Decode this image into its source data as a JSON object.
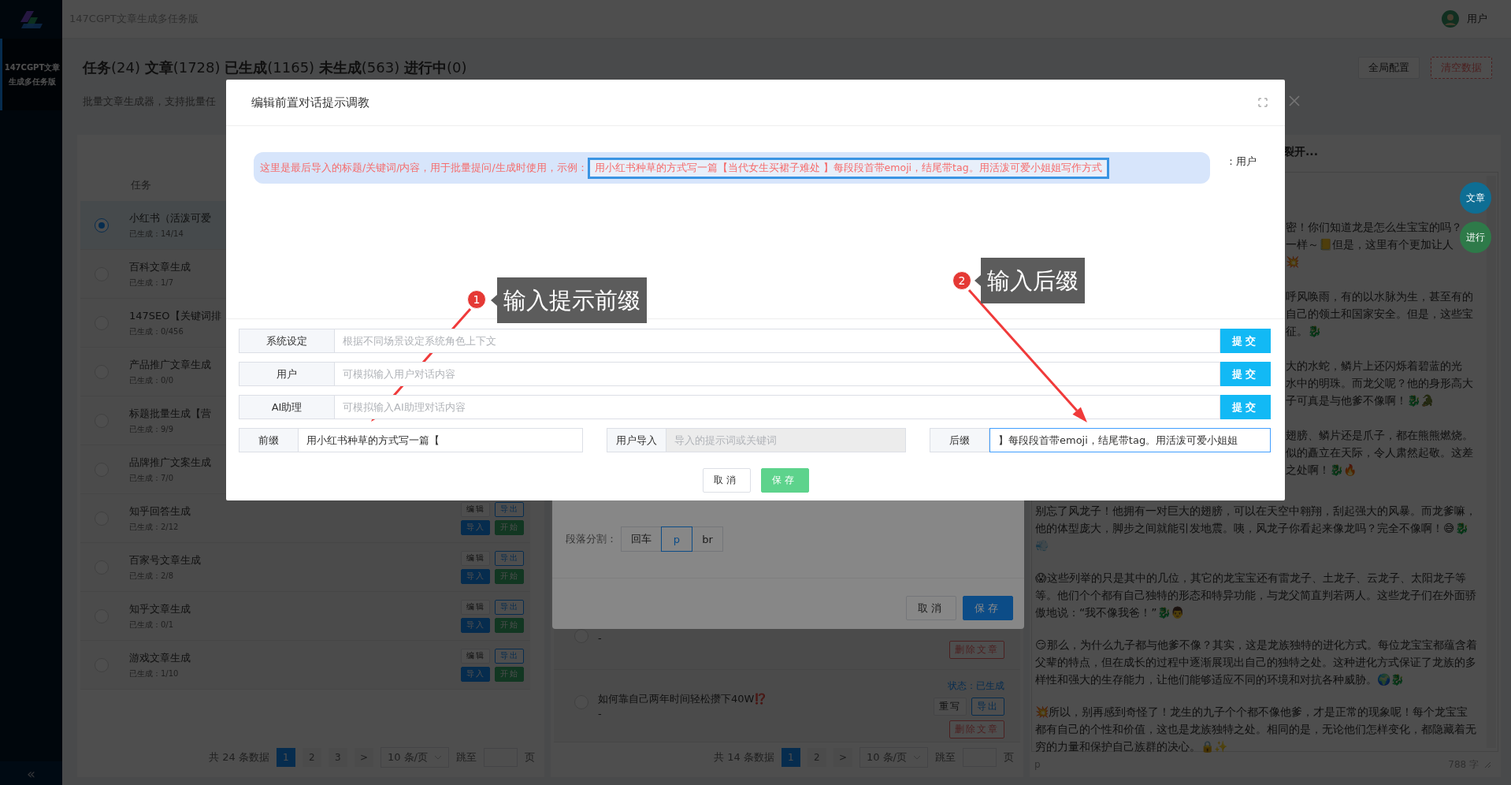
{
  "header": {
    "title": "147CGPT文章生成多任务版",
    "user": "用户"
  },
  "sidebar": {
    "items": [
      {
        "label": "147CGPT文章生成多任务版",
        "selected": true
      }
    ],
    "collapse": "«"
  },
  "page": {
    "title": "**任务**(24) **文章**(1728) **已生成**(1165) **未生成**(563) **进行中**(0)",
    "subtitle": "批量文章生成器，支持批量任",
    "buttons": [
      {
        "label": "全局配置",
        "kind": "default"
      },
      {
        "label": "清空数据",
        "kind": "danger-dashed"
      }
    ]
  },
  "tasks": {
    "header": "任务",
    "rows": [
      {
        "title": "小红书（活泼可爱",
        "progress": "已生成：14/14",
        "selected": true
      },
      {
        "title": "百科文章生成",
        "progress": "已生成：1/7",
        "selected": false
      },
      {
        "title": "147SEO【关键词排",
        "progress": "已生成：0/456",
        "selected": false
      },
      {
        "title": "产品推广文章生成",
        "progress": "已生成：0/0",
        "selected": false
      },
      {
        "title": "标题批量生成【营",
        "progress": "已生成：9/9",
        "selected": false
      },
      {
        "title": "品牌推广文案生成",
        "progress": "已生成：7/0",
        "selected": false
      },
      {
        "title": "知乎回答生成",
        "progress": "已生成：2/12",
        "selected": false,
        "actions": [
          {
            "label": "编辑",
            "kind": "default"
          },
          {
            "label": "导出",
            "kind": "outline"
          },
          {
            "label": "导入",
            "kind": "primary"
          },
          {
            "label": "开始",
            "kind": "success"
          }
        ]
      },
      {
        "title": "百家号文章生成",
        "progress": "已生成：2/8",
        "selected": false,
        "actions": [
          {
            "label": "编辑",
            "kind": "default"
          },
          {
            "label": "导出",
            "kind": "outline"
          },
          {
            "label": "导入",
            "kind": "primary"
          },
          {
            "label": "开始",
            "kind": "success"
          }
        ]
      },
      {
        "title": "知乎文章生成",
        "progress": "已生成：0/1",
        "selected": false,
        "actions": [
          {
            "label": "编辑",
            "kind": "default"
          },
          {
            "label": "导出",
            "kind": "outline"
          },
          {
            "label": "导入",
            "kind": "primary"
          },
          {
            "label": "开始",
            "kind": "success"
          }
        ]
      },
      {
        "title": "游戏文章生成",
        "progress": "已生成：1/10",
        "selected": false,
        "actions": [
          {
            "label": "编辑",
            "kind": "default"
          },
          {
            "label": "导出",
            "kind": "outline"
          },
          {
            "label": "导入",
            "kind": "primary"
          },
          {
            "label": "开始",
            "kind": "success"
          }
        ]
      }
    ],
    "pagination": {
      "total": "共 24 条数据",
      "pages": [
        {
          "label": "1",
          "selected": true
        },
        {
          "label": "2",
          "selected": false
        },
        {
          "label": "3",
          "selected": false
        }
      ],
      "next": ">",
      "page_size": "10 条/页",
      "jump": "跳至",
      "unit": "页"
    }
  },
  "articles": {
    "rows": [
      {
        "dash": "-",
        "selected": false,
        "actions": [
          {
            "label": "删除文章",
            "kind": "danger"
          }
        ]
      },
      {
        "title": "如何靠自己两年时间轻松攒下40W⁉️",
        "dash": "-",
        "status": "状态：已生成",
        "selected": false,
        "actions": [
          {
            "label": "重写",
            "kind": "default"
          },
          {
            "label": "导出",
            "kind": "outline"
          },
          {
            "label": "删除文章",
            "kind": "danger"
          }
        ]
      }
    ],
    "pagination": {
      "total": "共 14 条数据",
      "pages": [
        {
          "label": "1",
          "selected": true
        },
        {
          "label": "2",
          "selected": false
        }
      ],
      "next": ">",
      "page_size": "10 条/页",
      "jump": "跳至",
      "unit": "页"
    }
  },
  "preview": {
    "header": "裂开...",
    "fragments": [
      [
        "密！你们知道龙是怎么生宝宝的吗？",
        "一样～📒但是，这里有个更加让人",
        "💥"
      ],
      [
        "呼风唤雨，有的以水脉为生，甚至有的",
        "自己的领土和国家安全。但是，这些宝",
        "征。🐉"
      ],
      [
        "大的水蛇，鳞片上还闪烁着碧蓝的光",
        "水中的明珠。而龙父呢？他的身形高大",
        "子可真是与他爹不像啊！🐉🐊"
      ],
      [
        "翅膀、鳞片还是爪子，都在熊熊燃烧。",
        "似的矗立在天际，令人肃然起敬。这差",
        "之处啊！🐉🔥"
      ]
    ],
    "paragraphs": [
      "别忘了风龙子！他拥有一对巨大的翅膀，可以在天空中翱翔，刮起强大的风暴。而龙爹嘛，他的体型庞大，脚步之间就能引发地震。咦，风龙子你看起来像龙吗？完全不像啊！😅🐉💨",
      "😱这些列举的只是其中的几位，其它的龙宝宝还有雷龙子、土龙子、云龙子、太阳龙子等等。他们个个都有自己独特的形态和特异功能，与龙父简直判若两人。这些龙子们在外面骄傲地说：“我不像我爸！”🐉👨",
      "😏那么，为什么九子都与他爹不像？其实，这是龙族独特的进化方式。每位龙宝宝都蕴含着父辈的特点，但在成长的过程中逐渐展现出自己的独特之处。这种进化方式保证了龙族的多样性和强大的生存能力，让他们能够适应不同的环境和对抗各种威胁。🌍🐉",
      "💥所以，别再感到奇怪了！龙生的九子个个都不像他爹，才是正常的现象呢！每个龙宝宝都有自己的个性和价值，这也是龙族独特之处。相同的是，无论他们怎样变化，都隐藏着无穷的力量和保护自己族群的决心。🔒✨"
    ],
    "path": "p",
    "word_count": "788 字",
    "fabs": [
      {
        "label": "文章",
        "color": "#0e6e94"
      },
      {
        "label": "进行",
        "color": "#2e7a49"
      }
    ]
  },
  "split_dialog": {
    "label": "段落分割：",
    "options": [
      {
        "label": "回车",
        "selected": false
      },
      {
        "label": "p",
        "selected": true
      },
      {
        "label": "br",
        "selected": false
      }
    ],
    "buttons": [
      {
        "label": "取消",
        "kind": "default"
      },
      {
        "label": "保存",
        "kind": "primary"
      }
    ]
  },
  "dialog": {
    "title": "编辑前置对话提示调教",
    "message": {
      "intro": "这里是最后导入的标题/关键词/内容，用于批量提问/生成时使用，示例：",
      "example": "用小红书种草的方式写一篇【当代女生买裙子难处 】每段段首带emoji，结尾带tag。用活泼可爱小姐姐写作方式",
      "sender": "：用户"
    },
    "rows": [
      {
        "label": "系统设定",
        "placeholder": "根据不同场景设定系统角色上下文",
        "button": "提交"
      },
      {
        "label": "用户",
        "placeholder": "可模拟输入用户对话内容",
        "button": "提交"
      },
      {
        "label": "AI助理",
        "placeholder": "可模拟输入AI助理对话内容",
        "button": "提交"
      }
    ],
    "affixes": [
      {
        "label": "前缀",
        "value": "用小红书种草的方式写一篇【",
        "disabled": false,
        "focused": false
      },
      {
        "label": "用户导入",
        "placeholder": "导入的提示词或关键词",
        "disabled": true,
        "focused": false
      },
      {
        "label": "后缀",
        "value": "】每段段首带emoji，结尾带tag。用活泼可爱小姐姐",
        "disabled": false,
        "focused": true
      }
    ],
    "buttons": [
      {
        "label": "取消",
        "kind": "default"
      },
      {
        "label": "保存",
        "kind": "success"
      }
    ]
  },
  "annotations": [
    {
      "number": "1",
      "text": "输入提示前缀"
    },
    {
      "number": "2",
      "text": "输入后缀"
    }
  ]
}
